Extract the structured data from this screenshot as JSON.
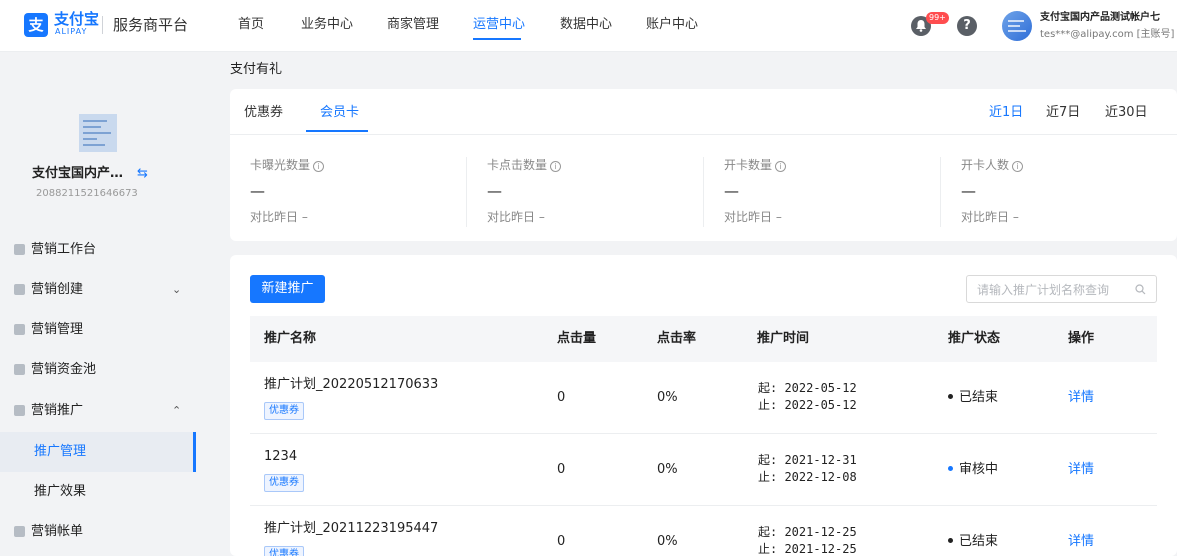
{
  "brand": {
    "mark": "支",
    "name": "支付宝",
    "sub": "ALIPAY",
    "platform": "服务商平台"
  },
  "nav": [
    {
      "label": "首页",
      "active": false
    },
    {
      "label": "业务中心",
      "active": false
    },
    {
      "label": "商家管理",
      "active": false
    },
    {
      "label": "运营中心",
      "active": true
    },
    {
      "label": "数据中心",
      "active": false
    },
    {
      "label": "账户中心",
      "active": false
    }
  ],
  "header": {
    "notification_badge": "99+",
    "help_glyph": "?",
    "account_name": "支付宝国内产品测试帐户七",
    "account_email": "tes***@alipay.com [主账号]"
  },
  "merchant": {
    "name": "支付宝国内产… ",
    "switch_glyph": "⇆",
    "id": "2088211521646673"
  },
  "menu": [
    {
      "label": "营销工作台",
      "icon": "home-icon",
      "caret": ""
    },
    {
      "label": "营销创建",
      "icon": "tag-icon",
      "caret": "⌄"
    },
    {
      "label": "营销管理",
      "icon": "manage-icon",
      "caret": ""
    },
    {
      "label": "营销资金池",
      "icon": "chart-icon",
      "caret": ""
    },
    {
      "label": "营销推广",
      "icon": "promote-icon",
      "caret": "⌃"
    }
  ],
  "submenu": [
    {
      "label": "推广管理",
      "active": true
    },
    {
      "label": "推广效果",
      "active": false
    }
  ],
  "menu_bottom": {
    "label": "营销帐单",
    "icon": "bill-icon"
  },
  "page": {
    "heading": "支付有礼"
  },
  "tabs": [
    {
      "label": "优惠券",
      "active": false
    },
    {
      "label": "会员卡",
      "active": true
    }
  ],
  "ranges": [
    {
      "label": "近1日",
      "active": true
    },
    {
      "label": "近7日",
      "active": false
    },
    {
      "label": "近30日",
      "active": false
    }
  ],
  "stats": [
    {
      "label": "卡曝光数量",
      "info": "i",
      "value": "—",
      "compare": "对比昨日 –"
    },
    {
      "label": "卡点击数量",
      "info": "i",
      "value": "—",
      "compare": "对比昨日 –"
    },
    {
      "label": "开卡数量",
      "info": "i",
      "value": "—",
      "compare": "对比昨日 –"
    },
    {
      "label": "开卡人数",
      "info": "i",
      "value": "—",
      "compare": "对比昨日 –"
    }
  ],
  "toolbar": {
    "new_label": "新建推广",
    "search_placeholder": "请输入推广计划名称查询"
  },
  "table": {
    "columns": [
      "推广名称",
      "点击量",
      "点击率",
      "推广时间",
      "推广状态",
      "操作"
    ],
    "rows": [
      {
        "name": "推广计划_20220512170633",
        "tag": "优惠券",
        "clicks": "0",
        "rate": "0%",
        "start": "起: 2022-05-12",
        "end": "止: 2022-05-12",
        "status": "已结束",
        "status_color": "#222222",
        "action": "详情"
      },
      {
        "name": "1234",
        "tag": "优惠券",
        "clicks": "0",
        "rate": "0%",
        "start": "起: 2021-12-31",
        "end": "止: 2022-12-08",
        "status": "审核中",
        "status_color": "#1677ff",
        "action": "详情"
      },
      {
        "name": "推广计划_20211223195447",
        "tag": "优惠券",
        "clicks": "0",
        "rate": "0%",
        "start": "起: 2021-12-25",
        "end": "止: 2021-12-25",
        "status": "已结束",
        "status_color": "#222222",
        "action": "详情"
      }
    ]
  },
  "colors": {
    "accent": "#1677ff",
    "badge": "#ff4d4f",
    "ended": "#222222",
    "reviewing": "#1677ff"
  }
}
